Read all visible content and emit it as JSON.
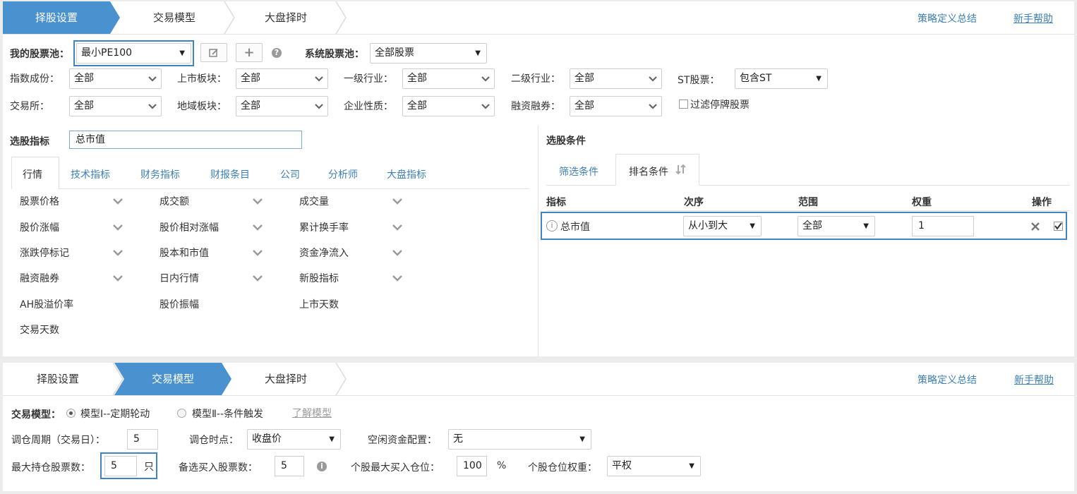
{
  "top_steps": {
    "tabs": [
      "择股设置",
      "交易模型",
      "大盘择时"
    ],
    "links": [
      "策略定义总结",
      "新手帮助"
    ]
  },
  "stock_pool": {
    "my_label": "我的股票池：",
    "my_value": "最小PE100",
    "system_label": "系统股票池：",
    "system_value": "全部股票"
  },
  "filters": {
    "row1": [
      {
        "label": "指数成份：",
        "value": "全部"
      },
      {
        "label": "上市板块：",
        "value": "全部"
      },
      {
        "label": "一级行业：",
        "value": "全部"
      },
      {
        "label": "二级行业：",
        "value": "全部"
      }
    ],
    "st_label": "ST股票：",
    "st_value": "包含ST",
    "row2": [
      {
        "label": "交易所：",
        "value": "全部"
      },
      {
        "label": "地域板块：",
        "value": "全部"
      },
      {
        "label": "企业性质：",
        "value": "全部"
      },
      {
        "label": "融资融券：",
        "value": "全部"
      }
    ],
    "suspend_label": "过滤停牌股票"
  },
  "indicators": {
    "label": "选股指标",
    "search_value": "总市值",
    "tabs": [
      "行情",
      "技术指标",
      "财务指标",
      "财报条目",
      "公司",
      "分析师",
      "大盘指标"
    ],
    "items": [
      [
        "股票价格",
        "成交额",
        "成交量"
      ],
      [
        "股价涨幅",
        "股价相对涨幅",
        "累计换手率"
      ],
      [
        "涨跌停标记",
        "股本和市值",
        "资金净流入"
      ],
      [
        "融资融券",
        "日内行情",
        "新股指标"
      ],
      [
        "AH股溢价率",
        "股价振幅",
        "上市天数"
      ],
      [
        "交易天数"
      ]
    ]
  },
  "conditions": {
    "title": "选股条件",
    "tabs": [
      "筛选条件",
      "排名条件"
    ],
    "sort_icon": "sort-arrows-icon",
    "headers": [
      "指标",
      "次序",
      "范围",
      "权重",
      "操作"
    ],
    "row": {
      "name": "总市值",
      "order": "从小到大",
      "range": "全部",
      "weight": "1"
    }
  },
  "trade_model": {
    "label": "交易模型：",
    "options": [
      "模型Ⅰ--定期轮动",
      "模型Ⅱ--条件触发"
    ],
    "learn_link": "了解模型",
    "period_label": "调仓周期（交易日）：",
    "period_value": "5",
    "time_label": "调仓时点：",
    "time_value": "收盘价",
    "idle_label": "空闲资金配置：",
    "idle_value": "无",
    "max_hold_label": "最大持仓股票数：",
    "max_hold_value": "5",
    "max_hold_unit": "只",
    "backup_label": "备选买入股票数：",
    "backup_value": "5",
    "max_pos_label": "个股最大买入仓位：",
    "max_pos_value": "100",
    "max_pos_unit": "%",
    "weight_label": "个股仓位权重：",
    "weight_value": "平权"
  },
  "colors": {
    "accent": "#4a92cf",
    "link": "#3d7fb5",
    "highlight": "#3d86c1"
  }
}
